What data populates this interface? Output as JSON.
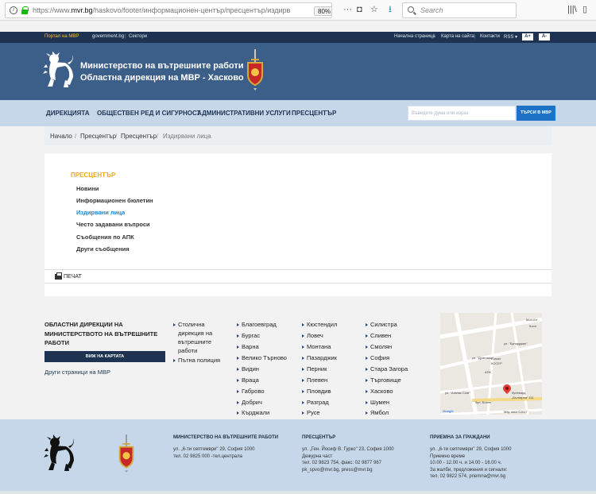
{
  "browser": {
    "url_prefix": "https://www.",
    "url_domain": "mvr.bg",
    "url_path": "/haskovo/footer/информационен-център/пресцентър/издирв",
    "zoom": "80%",
    "search_placeholder": "Search"
  },
  "top_strip": {
    "portal": "Портал на МВР",
    "gov": "government.bg",
    "sectors": "Сектори",
    "home": "Начална страница",
    "sitemap": "Карта на сайта",
    "contacts": "Контакти",
    "rss": "RSS ▾",
    "font_plus": "A+",
    "font_minus": "A-"
  },
  "header": {
    "line1": "Министерство на вътрешните работи",
    "line2": "Областна дирекция на МВР - Хасково"
  },
  "nav": {
    "items": [
      "ДИРЕКЦИЯТА",
      "ОБЩЕСТВЕН РЕД И СИГУРНОСТ",
      "АДМИНИСТРАТИВНИ УСЛУГИ",
      "ПРЕСЦЕНТЪР"
    ],
    "search_placeholder": "Въведете дума или израз",
    "search_button": "ТЪРСИ В МВР"
  },
  "breadcrumb": [
    "Начало",
    "Пресцентър",
    "Пресцентър",
    "Издирвани лица"
  ],
  "sidebar": {
    "title": "ПРЕСЦЕНТЪР",
    "items": [
      "Новини",
      "Информационен бюлетин",
      "Издирвани лица",
      "Често задавани въпроси",
      "Съобщения по АПК",
      "Други съобщения"
    ]
  },
  "print_label": "ПЕЧАТ",
  "directorates": {
    "title": "ОБЛАСТНИ ДИРЕКЦИИ НА МИНИСТЕРСТВОТО НА ВЪТРЕШНИТЕ РАБОТИ",
    "map_button": "ВИЖ НА КАРТАТА",
    "other_link": "Други страници на МВР",
    "col1": [
      "Столична",
      "дирекция на",
      "вътрешните",
      "работи",
      "Пътна полиция"
    ],
    "col2": [
      "Благоевград",
      "Бургас",
      "Варна",
      "Велико Търново",
      "Видин",
      "Враца",
      "Габрово",
      "Добрич",
      "Кърджали"
    ],
    "col3": [
      "Кюстендил",
      "Ловеч",
      "Монтана",
      "Пазарджик",
      "Перник",
      "Плевен",
      "Пловдив",
      "Разград",
      "Русе"
    ],
    "col4": [
      "Силистра",
      "Сливен",
      "Смолян",
      "София",
      "Стара Загора",
      "Търговище",
      "Хасково",
      "Шумен",
      "Ямбол"
    ]
  },
  "map": {
    "labels": [
      "Мон Ал",
      "Кооп",
      "ул. \"Бунарджик\"",
      "ул. \"Драгоман\"",
      "Kosser",
      "КОСЕР",
      "АПК",
      "ул. \"Атанас Скат\"",
      "бул. Ботев",
      "булевард",
      "„България\" 111",
      "Google",
      "Map data ©2017"
    ]
  },
  "footer": {
    "col1": {
      "head": "МИНИСТЕРСТВО НА ВЪТРЕШНИТЕ РАБОТИ",
      "lines": [
        "ул. „6-ти септември\" 29, София 1000",
        "тел. 02 9825 000 -тел.централа"
      ]
    },
    "col2": {
      "head": "ПРЕСЦЕНТЪР",
      "lines": [
        "ул. „Ген. Йосиф В. Гурко\" 23, София 1000",
        "Дежурна част",
        "тел. 02 9823 754, факс: 02 9877 967",
        "pk_spvo@mvr.bg, press@mvr.bg"
      ]
    },
    "col3": {
      "head": "ПРИЕМНА ЗА ГРАЖДАНИ",
      "lines": [
        "ул. „6-ти септември\" 29, София 1000",
        "Приемно време",
        "10.00 - 12.00 ч. и 14.00 - 16.00 ч.",
        "За жалби, предложения и сигнали:",
        "тел. 02 9822 574, priemna@mvr.bg"
      ]
    }
  }
}
